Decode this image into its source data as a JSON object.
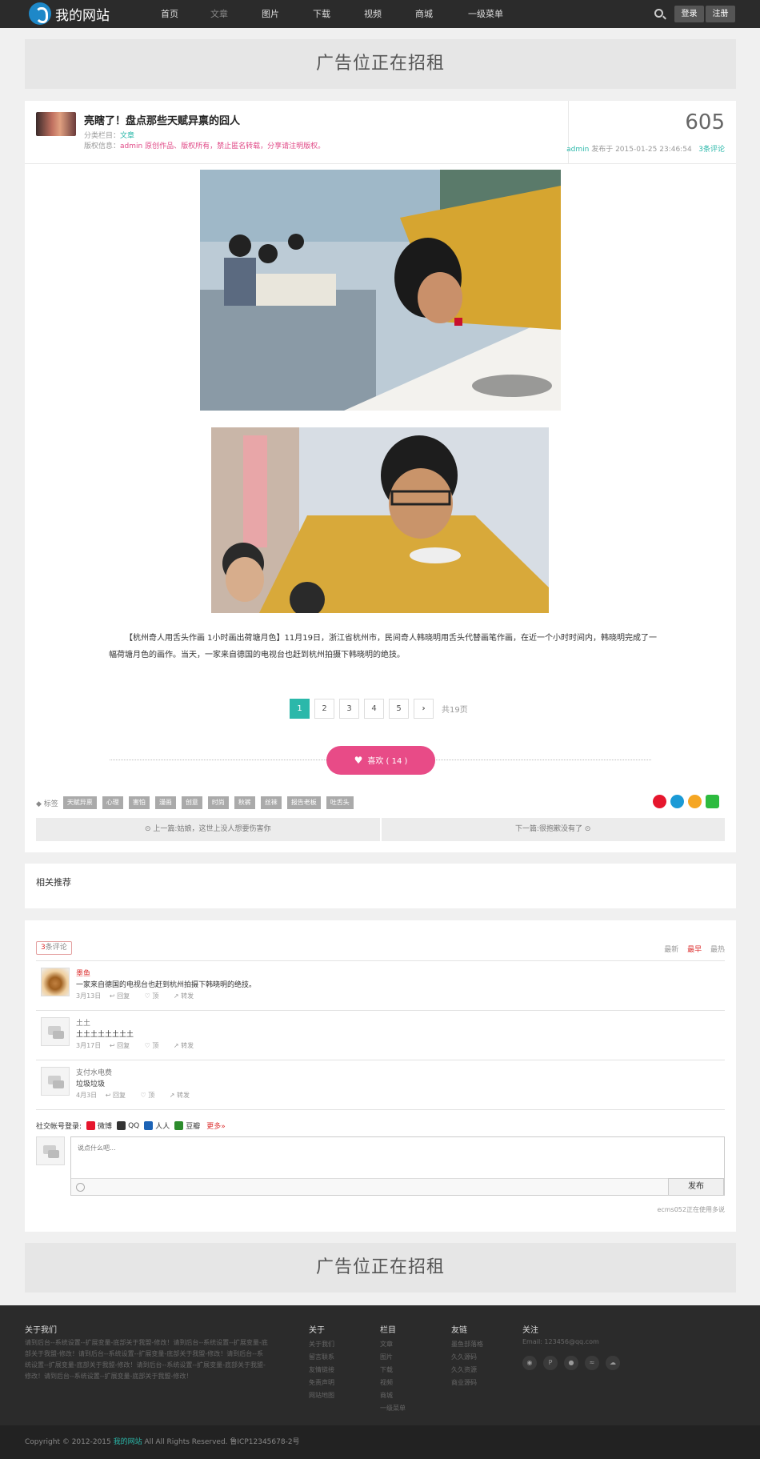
{
  "header": {
    "site_name": "我的网站",
    "nav": [
      "首页",
      "文章",
      "图片",
      "下载",
      "视频",
      "商城",
      "一级菜单"
    ],
    "login": "登录",
    "register": "注册"
  },
  "ad": {
    "text": "广告位正在招租"
  },
  "article": {
    "title": "亮瞎了！盘点那些天赋异禀的囧人",
    "category_label": "分类栏目：",
    "category": "文章",
    "copyright_label": "版权信息：",
    "copyright": "admin 原创作品、版权所有，禁止匿名转载，分享请注明版权。",
    "views": "605",
    "author": "admin",
    "published_label": "发布于",
    "published": "2015-01-25 23:46:54",
    "comments_link": "3条评论",
    "text": "【杭州奇人用舌头作画  1小时画出荷塘月色】11月19日，浙江省杭州市，民间奇人韩晓明用舌头代替画笔作画，在近一个小时时间内，韩晓明完成了一幅荷塘月色的画作。当天，一家来自德国的电视台也赶到杭州拍摄下韩晓明的绝技。"
  },
  "pagination": {
    "pages": [
      "1",
      "2",
      "3",
      "4",
      "5"
    ],
    "next": "›",
    "total": "共19页"
  },
  "like": {
    "label": "喜欢 ( 14 )"
  },
  "tags": {
    "label": "标签",
    "items": [
      "天赋异禀",
      "心理",
      "害怕",
      "漫画",
      "创意",
      "时尚",
      "秋裤",
      "丝袜",
      "报告老板",
      "吐舌头"
    ]
  },
  "prevnext": {
    "prev": "上一篇:姑娘，这世上没人想要伤害你",
    "next": "下一篇:很抱歉没有了"
  },
  "related": {
    "title": "相关推荐"
  },
  "comments": {
    "count_num": "3",
    "count_label": "条评论",
    "sort": [
      "最新",
      "最早",
      "最热"
    ],
    "items": [
      {
        "name": "墨鱼",
        "body": "一家来自德国的电视台也赶到杭州拍摄下韩晓明的绝技。",
        "date": "3月13日",
        "reply": "回复",
        "up": "顶",
        "share": "转发"
      },
      {
        "name": "土土",
        "body": "土土土土土土土土",
        "date": "3月17日",
        "reply": "回复",
        "up": "顶",
        "share": "转发"
      },
      {
        "name": "支付水电费",
        "body": "垃圾垃圾",
        "date": "4月3日",
        "reply": "回复",
        "up": "顶",
        "share": "转发"
      }
    ],
    "social_label": "社交帐号登录:",
    "social": [
      "微博",
      "QQ",
      "人人",
      "豆瓣"
    ],
    "more": "更多»",
    "placeholder": "说点什么吧...",
    "submit": "发布",
    "powered": "ecms052正在使用多说"
  },
  "footer": {
    "about_title": "关于我们",
    "about_text": "请到后台--系统设置--扩展变量-底部关于我盟-修改！请到后台--系统设置--扩展变量-底部关于我盟-修改！请到后台--系统设置--扩展变量-底部关于我盟-修改！请到后台--系统设置--扩展变量-底部关于我盟-修改！请到后台--系统设置--扩展变量-底部关于我盟-修改！请到后台--系统设置--扩展变量-底部关于我盟-修改！",
    "col1_title": "关于",
    "col1": [
      "关于我们",
      "留言联系",
      "友情链接",
      "免责声明",
      "网站地图"
    ],
    "col2_title": "栏目",
    "col2": [
      "文章",
      "图片",
      "下载",
      "视频",
      "商城",
      "一级菜单"
    ],
    "col3_title": "友链",
    "col3": [
      "墨鱼部落格",
      "久久源码",
      "久久资源",
      "商业源码"
    ],
    "col4_title": "关注",
    "email": "Email: 123456@qq.com",
    "copyright_pre": "Copyright © 2012-2015 ",
    "copyright_site": "我的网站",
    "copyright_post": " All All Rights Reserved. 鲁ICP12345678-2号"
  }
}
